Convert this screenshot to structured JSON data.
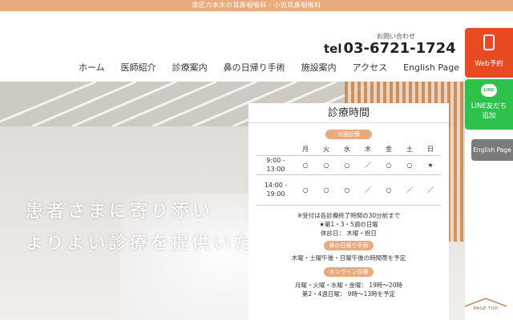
{
  "topbar": {
    "text": "港区六本木の耳鼻咽喉科・小児耳鼻咽喉科"
  },
  "contact": {
    "label": "お問い合わせ",
    "prefix": "tel",
    "number": "03-6721-1724"
  },
  "nav": {
    "items": [
      "ホーム",
      "医師紹介",
      "診療案内",
      "鼻の日帰り手術",
      "施設案内",
      "アクセス",
      "English Page"
    ]
  },
  "hero": {
    "line1": "患者さまに寄り添い",
    "line2": "よりよい診療を提供いたします"
  },
  "hours": {
    "title": "診療時間",
    "badge1": "対面診療",
    "days": [
      "月",
      "火",
      "水",
      "木",
      "金",
      "土",
      "日"
    ],
    "rows": [
      {
        "time": "9:00 - 13:00",
        "cells": [
          "○",
          "○",
          "○",
          "／",
          "○",
          "○",
          "★"
        ]
      },
      {
        "time1": "14:00 -",
        "time2": "19:00",
        "cells": [
          "○",
          "○",
          "○",
          "／",
          "○",
          "／",
          "／"
        ]
      }
    ],
    "note1": "※受付は各診療終了時間の30分前まで",
    "note2": "★第1・3・5週の日曜",
    "note3": "休診日： 木曜・祝日",
    "badge2": "鼻の日帰り手術",
    "note4": "木曜・土曜午後・日曜午後の時間帯を予定",
    "badge3": "オンライン診療",
    "note5": "月曜・火曜・水曜・金曜： 19時〜20時",
    "note6": "第2・4週日曜： 9時〜13時を予定"
  },
  "side": {
    "web": "Web予約",
    "line_icon": "LINE",
    "line1": "LINE友だち",
    "line2": "追加",
    "english": "English Page"
  },
  "pagetop": {
    "label": "PAGE TOP"
  },
  "icons": {
    "web": "smartphone-icon",
    "line": "line-icon",
    "pagetop": "roof-arrow-icon"
  },
  "colors": {
    "accent": "#e9ab7d",
    "web": "#e84a23",
    "line": "#2fc24b",
    "english": "#7b7b7b"
  }
}
